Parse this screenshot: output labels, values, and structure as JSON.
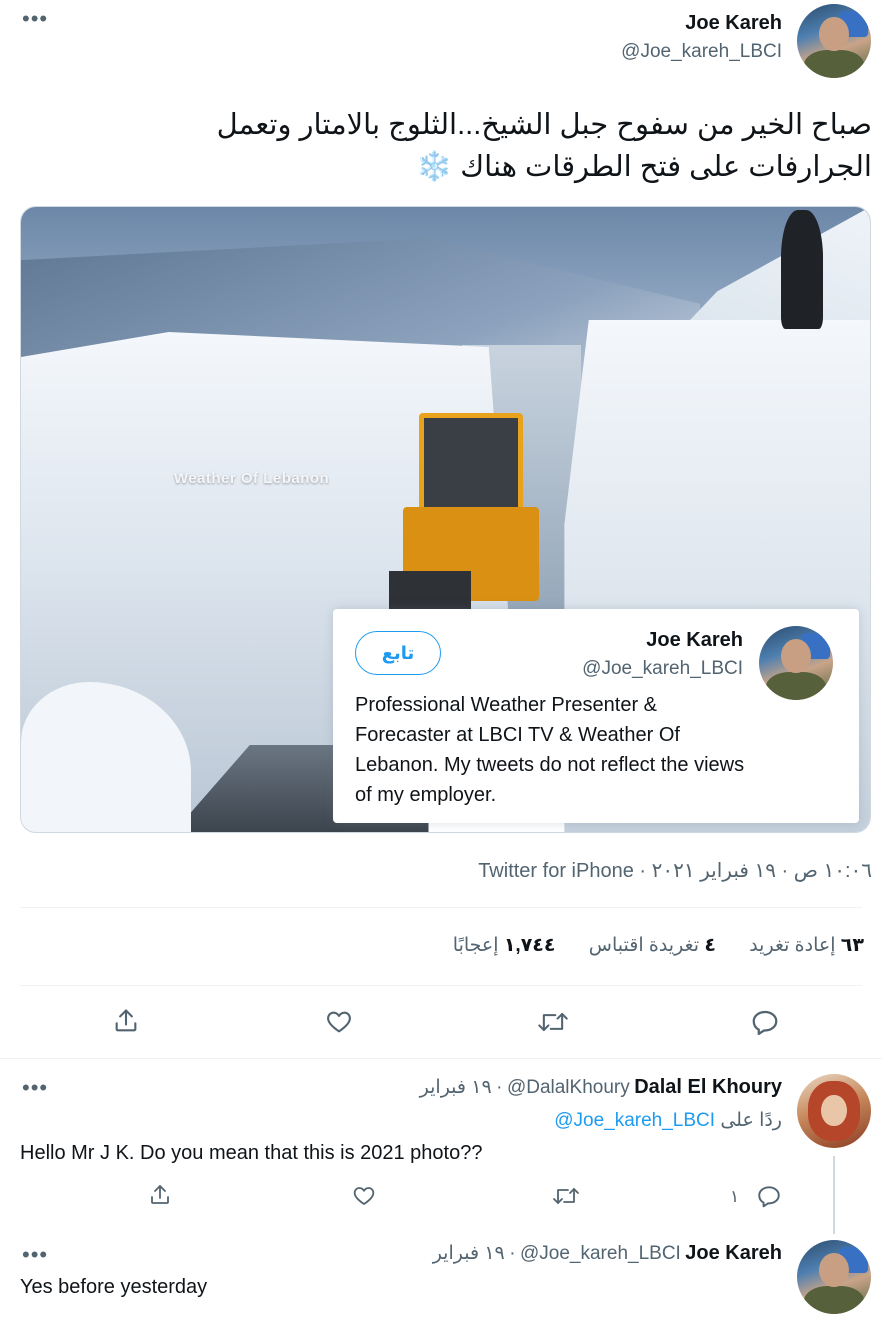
{
  "tweet": {
    "author_name": "Joe Kareh",
    "author_handle": "@Joe_kareh_LBCI",
    "text_line1": "صباح الخير من سفوح جبل الشيخ...الثلوج بالامتار وتعمل",
    "text_line2": "الجرارفات على فتح الطرقات هناك ❄️",
    "image_watermark": "Weather Of Lebanon",
    "meta": "١٠:٠٦ ص · ١٩ فبراير ٢٠٢١ · Twitter for iPhone",
    "stats": {
      "retweets_count": "٦٣",
      "retweets_label": "إعادة تغريد",
      "quotes_count": "٤",
      "quotes_label": "تغريدة اقتباس",
      "likes_count": "١,٧٤٤",
      "likes_label": "إعجابًا"
    }
  },
  "hover_card": {
    "name": "Joe Kareh",
    "handle": "@Joe_kareh_LBCI",
    "follow_label": "تابع",
    "bio": "Professional Weather Presenter & Forecaster at LBCI TV & Weather Of Lebanon. My tweets do not reflect the views of my employer."
  },
  "replies": [
    {
      "name": "Dalal El Khoury",
      "handle": "@DalalKhoury",
      "date": "١٩ فبراير",
      "separator": "·",
      "replying_prefix": "ردًا على",
      "replying_to": "@Joe_kareh_LBCI",
      "text": "Hello Mr J K. Do you mean that this is 2021 photo??",
      "reply_count": "١"
    },
    {
      "name": "Joe Kareh",
      "handle": "@Joe_kareh_LBCI",
      "date": "١٩ فبراير",
      "separator": "·",
      "text": "Yes before yesterday"
    }
  ],
  "icons": {
    "more": "more-dots-icon",
    "share": "share-icon",
    "like": "heart-icon",
    "retweet": "retweet-icon",
    "reply": "reply-icon"
  },
  "colors": {
    "accent": "#1d9bf0",
    "secondary_text": "#536471",
    "primary_text": "#0f1419",
    "border": "#eff3f4"
  }
}
